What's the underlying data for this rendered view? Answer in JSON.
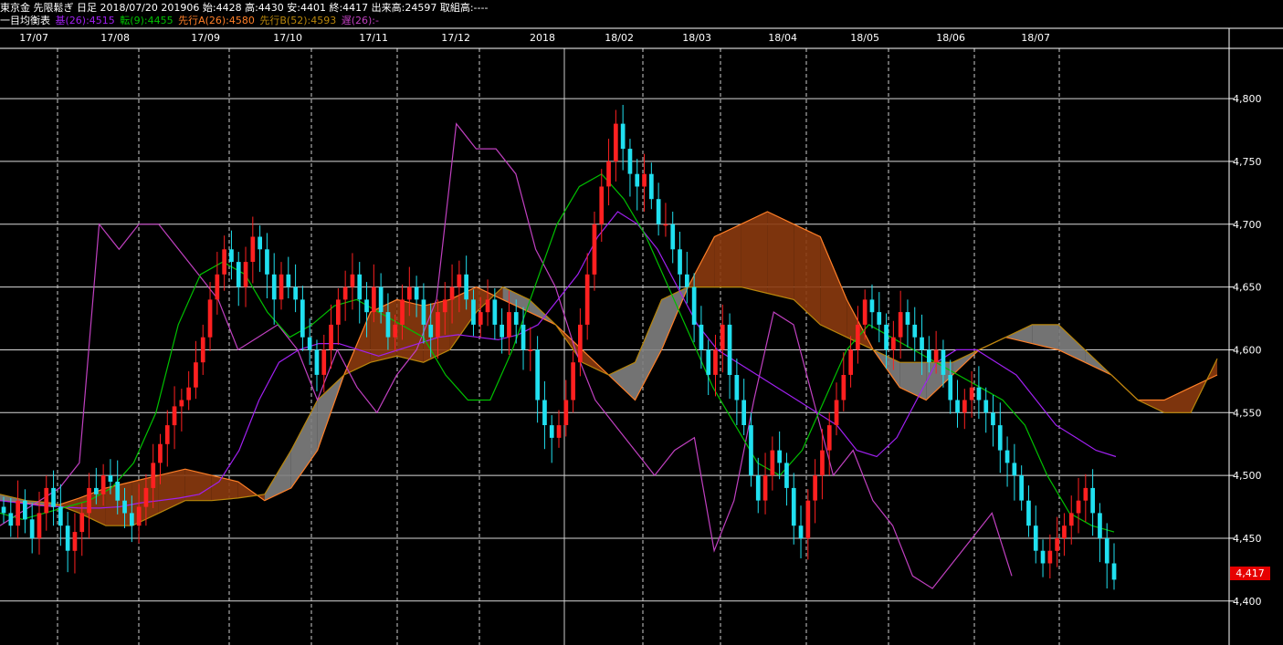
{
  "header": {
    "line1": "東京金 先限鬆ぎ 日足 2018/07/20 201906 始:4428 高:4430 安:4401 終:4417 出来高:24597 取組高:----",
    "indicator_label": "一目均衡表",
    "kijun": "基(26):4515",
    "tenkan": "転(9):4455",
    "senkou_a": "先行A(26):4580",
    "senkou_b": "先行B(52):4593",
    "chikou": "遅(26):-"
  },
  "colors": {
    "kijun": "#a020f0",
    "tenkan": "#00c000",
    "senkou_a": "#ff7f27",
    "senkou_b": "#b8860b",
    "chikou": "#c040c0",
    "candle_up": "#ff2020",
    "candle_down": "#20e0f0",
    "cloud_bull": "#8b3a0e",
    "cloud_bear": "#808080",
    "last_price_tag": "#e60000"
  },
  "last_price_tag": "4,417",
  "chart_data": {
    "type": "candlestick-ichimoku",
    "title": "",
    "x_tick_labels": [
      "17/07",
      "17/08",
      "17/09",
      "17/10",
      "17/11",
      "17/12",
      "2018",
      "18/02",
      "18/03",
      "18/04",
      "18/05",
      "18/06",
      "18/07"
    ],
    "y_tick_labels": [
      "4,400",
      "4,450",
      "4,500",
      "4,550",
      "4,600",
      "4,650",
      "4,700",
      "4,750",
      "4,800"
    ],
    "y_ticks": [
      4400,
      4450,
      4500,
      4550,
      4600,
      4650,
      4700,
      4750,
      4800
    ],
    "ylim": [
      4365,
      4840
    ],
    "grid": true,
    "close": [
      4470,
      4460,
      4480,
      4465,
      4450,
      4470,
      4490,
      4475,
      4460,
      4440,
      4455,
      4470,
      4490,
      4485,
      4500,
      4495,
      4480,
      4470,
      4460,
      4475,
      4490,
      4510,
      4525,
      4540,
      4555,
      4560,
      4570,
      4590,
      4610,
      4640,
      4660,
      4680,
      4670,
      4650,
      4670,
      4690,
      4680,
      4660,
      4640,
      4660,
      4650,
      4640,
      4610,
      4600,
      4580,
      4600,
      4620,
      4640,
      4650,
      4660,
      4640,
      4630,
      4650,
      4630,
      4610,
      4620,
      4640,
      4650,
      4640,
      4620,
      4610,
      4630,
      4640,
      4650,
      4660,
      4640,
      4620,
      4630,
      4640,
      4620,
      4610,
      4630,
      4620,
      4600,
      4600,
      4560,
      4540,
      4530,
      4540,
      4560,
      4590,
      4620,
      4660,
      4700,
      4730,
      4750,
      4780,
      4760,
      4740,
      4730,
      4740,
      4720,
      4700,
      4700,
      4680,
      4660,
      4650,
      4620,
      4600,
      4580,
      4600,
      4620,
      4580,
      4560,
      4540,
      4500,
      4480,
      4500,
      4520,
      4510,
      4490,
      4460,
      4450,
      4480,
      4500,
      4520,
      4540,
      4560,
      4580,
      4600,
      4620,
      4640,
      4630,
      4620,
      4600,
      4610,
      4630,
      4620,
      4610,
      4600,
      4590,
      4600,
      4580,
      4560,
      4550,
      4560,
      4570,
      4560,
      4550,
      4540,
      4520,
      4510,
      4500,
      4480,
      4460,
      4440,
      4430,
      4440,
      4450,
      4460,
      4470,
      4480,
      4490,
      4470,
      4450,
      4430,
      4417
    ],
    "kijun": [
      4480,
      4478,
      4476,
      4475,
      4474,
      4474,
      4475,
      4478,
      4480,
      4482,
      4485,
      4495,
      4520,
      4560,
      4590,
      4600,
      4605,
      4605,
      4600,
      4595,
      4600,
      4605,
      4610,
      4612,
      4610,
      4608,
      4612,
      4620,
      4640,
      4660,
      4690,
      4710,
      4700,
      4680,
      4650,
      4620,
      4600,
      4590,
      4580,
      4570,
      4560,
      4550,
      4540,
      4520,
      4515,
      4530,
      4560,
      4590,
      4600,
      4600,
      4590,
      4580,
      4560,
      4540,
      4530,
      4520,
      4515
    ],
    "tenkan": [
      4470,
      4465,
      4470,
      4475,
      4480,
      4490,
      4510,
      4550,
      4620,
      4660,
      4670,
      4660,
      4630,
      4610,
      4620,
      4635,
      4640,
      4630,
      4620,
      4610,
      4580,
      4560,
      4560,
      4600,
      4650,
      4700,
      4730,
      4740,
      4720,
      4690,
      4650,
      4610,
      4570,
      4540,
      4510,
      4500,
      4520,
      4560,
      4600,
      4620,
      4610,
      4600,
      4590,
      4580,
      4570,
      4560,
      4540,
      4500,
      4470,
      4460,
      4455
    ],
    "senkou_a": [
      4480,
      4478,
      4475,
      4482,
      4490,
      4495,
      4500,
      4505,
      4500,
      4495,
      4480,
      4490,
      4520,
      4580,
      4630,
      4640,
      4635,
      4640,
      4650,
      4640,
      4630,
      4620,
      4600,
      4580,
      4560,
      4600,
      4650,
      4690,
      4700,
      4710,
      4700,
      4690,
      4640,
      4600,
      4570,
      4560,
      4580,
      4600,
      4610,
      4605,
      4600,
      4590,
      4580,
      4560,
      4560,
      4570,
      4580
    ],
    "senkou_b": [
      4485,
      4480,
      4478,
      4470,
      4460,
      4460,
      4470,
      4480,
      4480,
      4482,
      4485,
      4520,
      4560,
      4580,
      4590,
      4595,
      4590,
      4600,
      4630,
      4650,
      4640,
      4620,
      4590,
      4580,
      4590,
      4640,
      4650,
      4650,
      4650,
      4645,
      4640,
      4620,
      4610,
      4600,
      4590,
      4590,
      4590,
      4600,
      4610,
      4620,
      4620,
      4600,
      4580,
      4560,
      4550,
      4550,
      4593
    ],
    "chikou": [
      4460,
      4470,
      4480,
      4490,
      4510,
      4700,
      4680,
      4700,
      4700,
      4680,
      4660,
      4640,
      4600,
      4610,
      4620,
      4600,
      4560,
      4600,
      4570,
      4550,
      4580,
      4600,
      4640,
      4780,
      4760,
      4760,
      4740,
      4680,
      4650,
      4600,
      4560,
      4540,
      4520,
      4500,
      4520,
      4530,
      4440,
      4480,
      4560,
      4630,
      4620,
      4560,
      4500,
      4520,
      4480,
      4460,
      4420,
      4410,
      4430,
      4450,
      4470,
      4420
    ]
  }
}
